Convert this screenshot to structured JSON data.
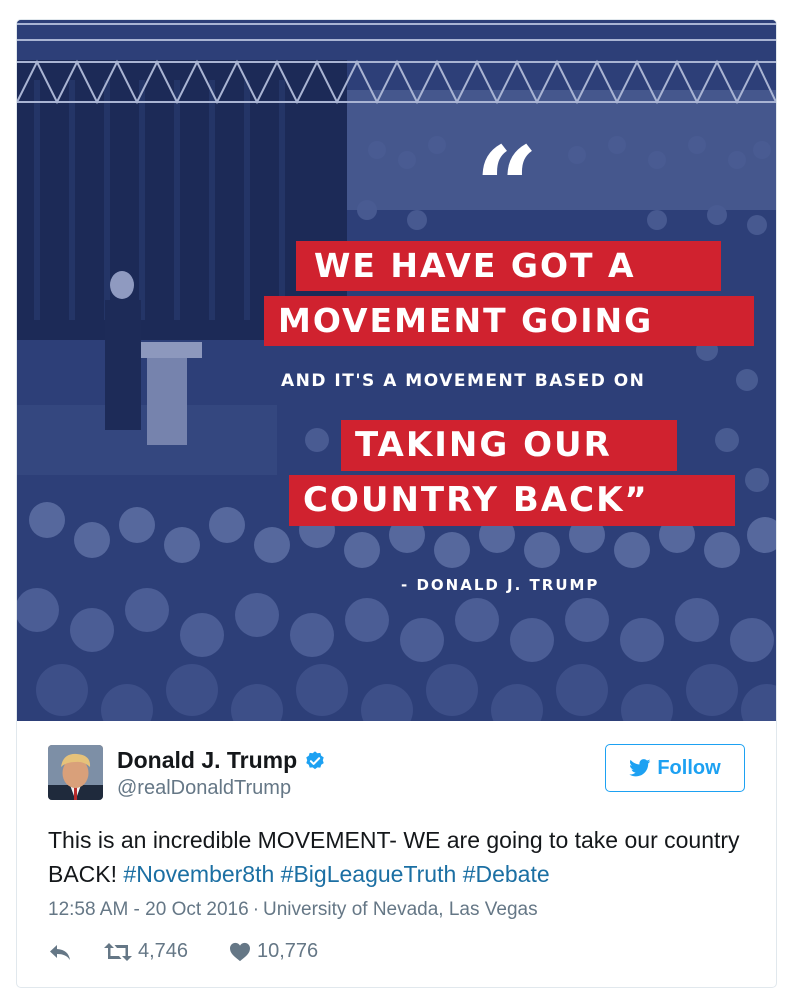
{
  "media": {
    "quote_mark": "“",
    "quote_lines": [
      "WE HAVE GOT A",
      "MOVEMENT GOING"
    ],
    "quote_sub": "AND IT'S A MOVEMENT BASED ON",
    "quote_lines_2": [
      "TAKING OUR",
      "COUNTRY BACK”"
    ],
    "attribution": "- DONALD J. TRUMP",
    "accent_red": "#d0222f",
    "overlay_blue": "#2d3f78"
  },
  "tweet": {
    "display_name": "Donald J. Trump",
    "handle": "@realDonaldTrump",
    "follow_label": "Follow",
    "text_plain": "This is an incredible MOVEMENT- WE are going to take our country BACK! ",
    "hashtags": [
      "#November8th",
      "#BigLeagueTruth",
      "#Debate"
    ],
    "timestamp": "12:58 AM - 20 Oct 2016",
    "separator": "·",
    "location": "University of Nevada, Las Vegas",
    "retweets": "4,746",
    "likes": "10,776"
  },
  "icons": {
    "verified": "verified-badge-icon",
    "follow": "twitter-bird-icon",
    "reply": "reply-icon",
    "retweet": "retweet-icon",
    "like": "heart-icon"
  },
  "colors": {
    "link": "#1b6fa3",
    "brand": "#1da1f2",
    "muted": "#657786"
  }
}
